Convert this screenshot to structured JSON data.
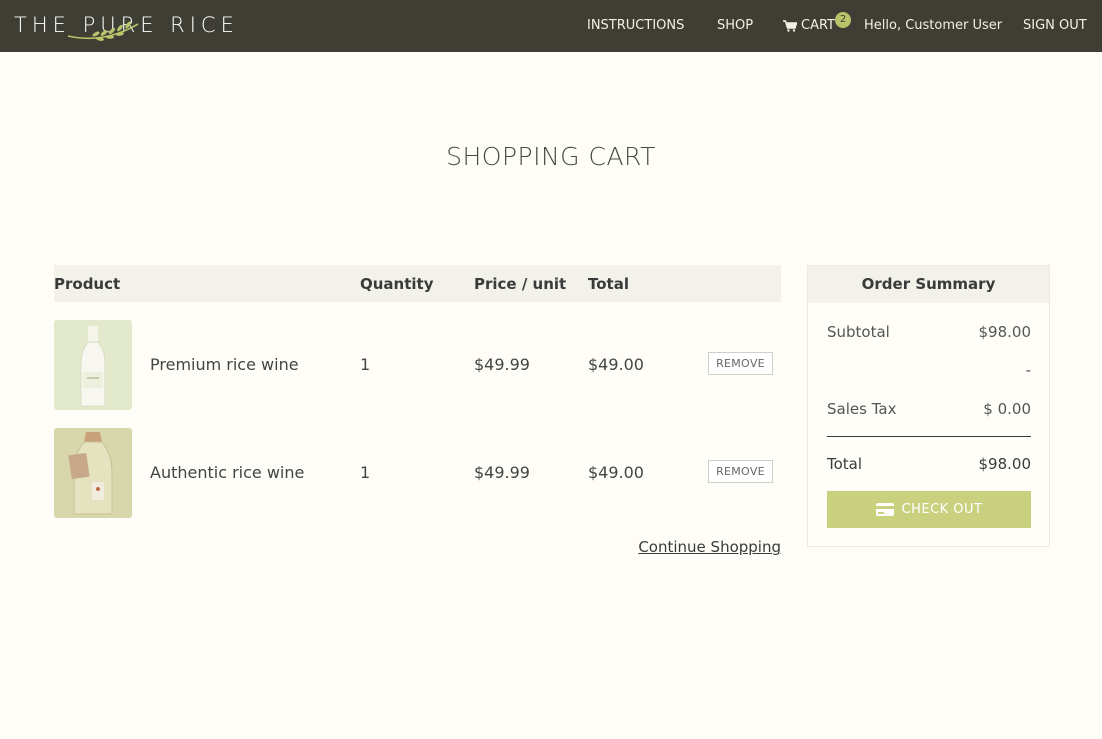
{
  "brand": {
    "name": "THE PURE RICE"
  },
  "nav": {
    "instructions": "INSTRUCTIONS",
    "shop": "SHOP",
    "cart": "CART",
    "cart_count": "2",
    "greeting": "Hello, Customer User",
    "sign_out": "SIGN OUT"
  },
  "page_title": "SHOPPING CART",
  "table": {
    "headers": {
      "product": "Product",
      "quantity": "Quantity",
      "price": "Price / unit",
      "total": "Total"
    },
    "rows": [
      {
        "name": "Premium rice wine",
        "qty": "1",
        "price": "$49.99",
        "total": "$49.00",
        "remove": "REMOVE",
        "thumb_color": "#e7ecd0"
      },
      {
        "name": "Authentic rice wine",
        "qty": "1",
        "price": "$49.99",
        "total": "$49.00",
        "remove": "REMOVE",
        "thumb_color": "#d9d6a7"
      }
    ],
    "continue": "Continue Shopping"
  },
  "summary": {
    "title": "Order Summary",
    "subtotal_label": "Subtotal",
    "subtotal_value": "$98.00",
    "discount_value": "-",
    "tax_label": "Sales Tax",
    "tax_value": "$ 0.00",
    "total_label": "Total",
    "total_value": "$98.00",
    "checkout": "CHECK OUT"
  },
  "colors": {
    "nav_bg": "#3f3e35",
    "accent": "#c9d17f",
    "badge": "#b7c46a",
    "page_bg": "#fefdf8"
  },
  "icons": [
    "cart-icon",
    "credit-card-icon",
    "rice-sprig-logo"
  ]
}
